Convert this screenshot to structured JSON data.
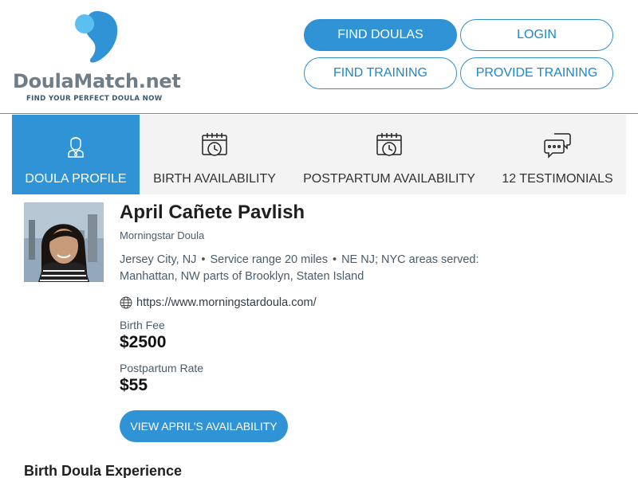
{
  "brand": {
    "name_main": "DoulaMatch",
    "name_suffix": ".net",
    "tagline": "FIND YOUR PERFECT DOULA NOW",
    "colors": {
      "primary": "#2f93d5",
      "logo_light": "#5bbff0",
      "text_gray": "#6f7d89"
    }
  },
  "nav": {
    "find_doulas": "FIND DOULAS",
    "login": "LOGIN",
    "find_training": "FIND TRAINING",
    "provide_training": "PROVIDE TRAINING"
  },
  "tabs": [
    {
      "label": "DOULA PROFILE",
      "icon": "doula-person-icon",
      "active": true
    },
    {
      "label": "BIRTH AVAILABILITY",
      "icon": "calendar-clock-icon",
      "active": false
    },
    {
      "label": "POSTPARTUM AVAILABILITY",
      "icon": "calendar-clock-icon",
      "active": false
    },
    {
      "label": "12 TESTIMONIALS",
      "icon": "chat-bubbles-icon",
      "active": false
    }
  ],
  "profile": {
    "name": "April Cañete Pavlish",
    "business": "Morningstar Doula",
    "city": "Jersey City, NJ",
    "service_range": "Service range 20 miles",
    "areas": "NE NJ; NYC areas served: Manhattan, NW parts of Brooklyn, Staten Island",
    "website": "https://www.morningstardoula.com/",
    "birth_fee_label": "Birth Fee",
    "birth_fee": "$2500",
    "postpartum_rate_label": "Postpartum Rate",
    "postpartum_rate": "$55",
    "availability_button": "VIEW APRIL'S AVAILABILITY"
  },
  "sections": {
    "experience_heading": "Birth Doula Experience"
  }
}
